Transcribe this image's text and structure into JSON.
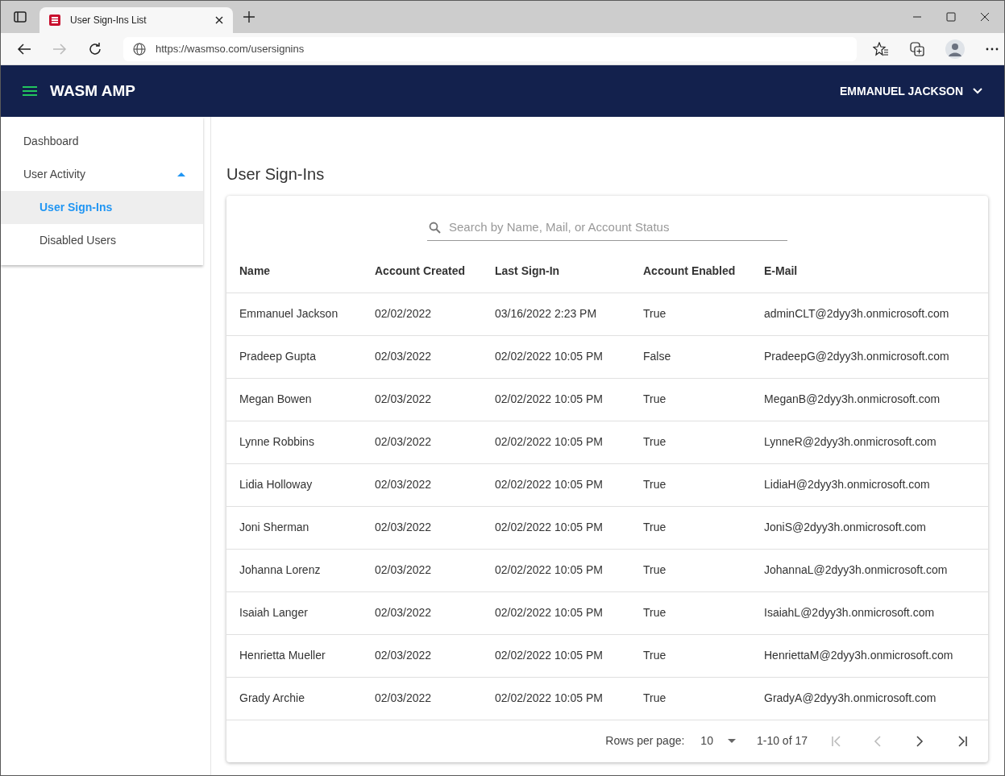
{
  "browser": {
    "tab_title": "User Sign-Ins List",
    "url": "https://wasmso.com/usersignins"
  },
  "app": {
    "title": "WASM AMP",
    "user": "EMMANUEL JACKSON"
  },
  "sidebar": {
    "items": [
      {
        "label": "Dashboard",
        "selected": false
      },
      {
        "label": "User Activity",
        "selected": false,
        "expanded": true,
        "children": [
          {
            "label": "User Sign-Ins",
            "selected": true
          },
          {
            "label": "Disabled Users",
            "selected": false
          }
        ]
      }
    ]
  },
  "page_title": "User Sign-Ins",
  "search": {
    "placeholder": "Search by Name, Mail, or Account Status"
  },
  "table": {
    "columns": [
      "Name",
      "Account Created",
      "Last Sign-In",
      "Account Enabled",
      "E-Mail"
    ],
    "rows": [
      [
        "Emmanuel Jackson",
        "02/02/2022",
        "03/16/2022 2:23 PM",
        "True",
        "adminCLT@2dyy3h.onmicrosoft.com"
      ],
      [
        "Pradeep Gupta",
        "02/03/2022",
        "02/02/2022 10:05 PM",
        "False",
        "PradeepG@2dyy3h.onmicrosoft.com"
      ],
      [
        "Megan Bowen",
        "02/03/2022",
        "02/02/2022 10:05 PM",
        "True",
        "MeganB@2dyy3h.onmicrosoft.com"
      ],
      [
        "Lynne Robbins",
        "02/03/2022",
        "02/02/2022 10:05 PM",
        "True",
        "LynneR@2dyy3h.onmicrosoft.com"
      ],
      [
        "Lidia Holloway",
        "02/03/2022",
        "02/02/2022 10:05 PM",
        "True",
        "LidiaH@2dyy3h.onmicrosoft.com"
      ],
      [
        "Joni Sherman",
        "02/03/2022",
        "02/02/2022 10:05 PM",
        "True",
        "JoniS@2dyy3h.onmicrosoft.com"
      ],
      [
        "Johanna Lorenz",
        "02/03/2022",
        "02/02/2022 10:05 PM",
        "True",
        "JohannaL@2dyy3h.onmicrosoft.com"
      ],
      [
        "Isaiah Langer",
        "02/03/2022",
        "02/02/2022 10:05 PM",
        "True",
        "IsaiahL@2dyy3h.onmicrosoft.com"
      ],
      [
        "Henrietta Mueller",
        "02/03/2022",
        "02/02/2022 10:05 PM",
        "True",
        "HenriettaM@2dyy3h.onmicrosoft.com"
      ],
      [
        "Grady Archie",
        "02/03/2022",
        "02/02/2022 10:05 PM",
        "True",
        "GradyA@2dyy3h.onmicrosoft.com"
      ]
    ]
  },
  "pagination": {
    "rows_per_page_label": "Rows per page:",
    "rows_per_page": "10",
    "range": "1-10 of 17",
    "buttons": [
      {
        "kind": "first",
        "disabled": true
      },
      {
        "kind": "previous",
        "disabled": true
      },
      {
        "kind": "next",
        "disabled": false
      },
      {
        "kind": "last",
        "disabled": false
      }
    ]
  }
}
